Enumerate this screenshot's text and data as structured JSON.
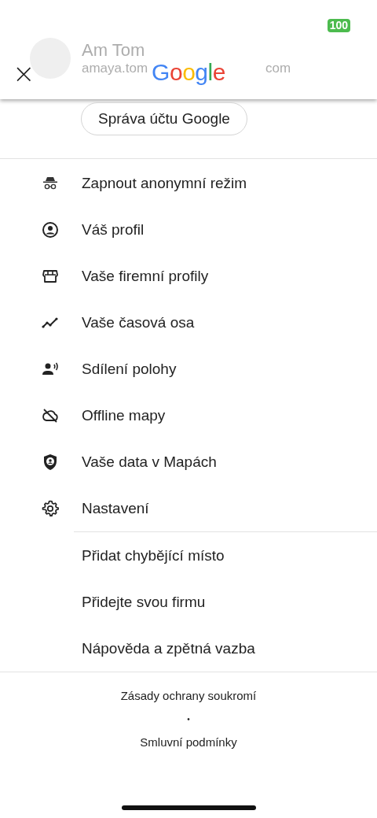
{
  "status_bar": {
    "battery": "100"
  },
  "account": {
    "name": "Am Tom",
    "email_start": "amaya.tom",
    "email_end": "com"
  },
  "header": {
    "close": "×",
    "logo": "Google"
  },
  "manage_button": "Správa účtu Google",
  "menu": [
    {
      "kind": "incognito",
      "label": "Zapnout anonymní režim"
    },
    {
      "kind": "profile",
      "label": "Váš profil"
    },
    {
      "kind": "store",
      "label": "Vaše firemní profily"
    },
    {
      "kind": "timeline",
      "label": "Vaše časová osa"
    },
    {
      "kind": "share",
      "label": "Sdílení polohy"
    },
    {
      "kind": "offline",
      "label": "Offline mapy"
    },
    {
      "kind": "shield",
      "label": "Vaše data v Mapách"
    },
    {
      "kind": "gear",
      "label": "Nastavení"
    }
  ],
  "secondary_menu": [
    "Přidat chybějící místo",
    "Přidejte svou firmu",
    "Nápověda a zpětná vazba"
  ],
  "footer": {
    "links": [
      "Zásady ochrany soukromí",
      "Smluvní podmínky"
    ],
    "separator": "•"
  }
}
